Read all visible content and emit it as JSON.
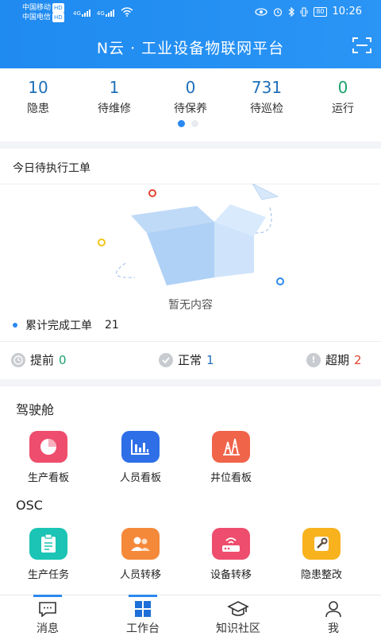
{
  "status_bar": {
    "carrier1": "中国移动",
    "carrier2": "中国电信",
    "hd": "HD",
    "net1": "4G",
    "net2": "4G",
    "battery": "80",
    "time": "10:26"
  },
  "header": {
    "title": "N云 · 工业设备物联网平台"
  },
  "stats": [
    {
      "value": "10",
      "label": "隐患"
    },
    {
      "value": "1",
      "label": "待维修"
    },
    {
      "value": "0",
      "label": "待保养"
    },
    {
      "value": "731",
      "label": "待巡检"
    },
    {
      "value": "0",
      "label": "运行"
    }
  ],
  "stat_colors": {
    "number": "#1f6fb8",
    "running": "#1aa36b"
  },
  "orders": {
    "title": "今日待执行工单",
    "empty_text": "暂无内容",
    "completed_label": "累计完成工单",
    "completed_count": "21",
    "early_label": "提前",
    "early_count": "0",
    "normal_label": "正常",
    "normal_count": "1",
    "overdue_label": "超期",
    "overdue_count": "2"
  },
  "cockpit": {
    "title": "驾驶舱",
    "apps": [
      {
        "label": "生产看板",
        "icon": "pie-chart-icon",
        "color": "#ee4d6d"
      },
      {
        "label": "人员看板",
        "icon": "bar-chart-icon",
        "color": "#2e6fe8"
      },
      {
        "label": "井位看板",
        "icon": "oil-rig-icon",
        "color": "#f0644a"
      }
    ]
  },
  "osc": {
    "title": "OSC",
    "apps": [
      {
        "label": "生产任务",
        "icon": "clipboard-icon",
        "color": "#1bc4b4"
      },
      {
        "label": "人员转移",
        "icon": "people-icon",
        "color": "#f5893a"
      },
      {
        "label": "设备转移",
        "icon": "router-icon",
        "color": "#ee4d6d"
      },
      {
        "label": "隐患整改",
        "icon": "wrench-icon",
        "color": "#f8b21e"
      }
    ]
  },
  "tabbar": [
    {
      "label": "消息",
      "icon": "message-icon"
    },
    {
      "label": "工作台",
      "icon": "grid-icon",
      "active": true
    },
    {
      "label": "知识社区",
      "icon": "graduation-cap-icon"
    },
    {
      "label": "我",
      "icon": "user-icon"
    }
  ]
}
